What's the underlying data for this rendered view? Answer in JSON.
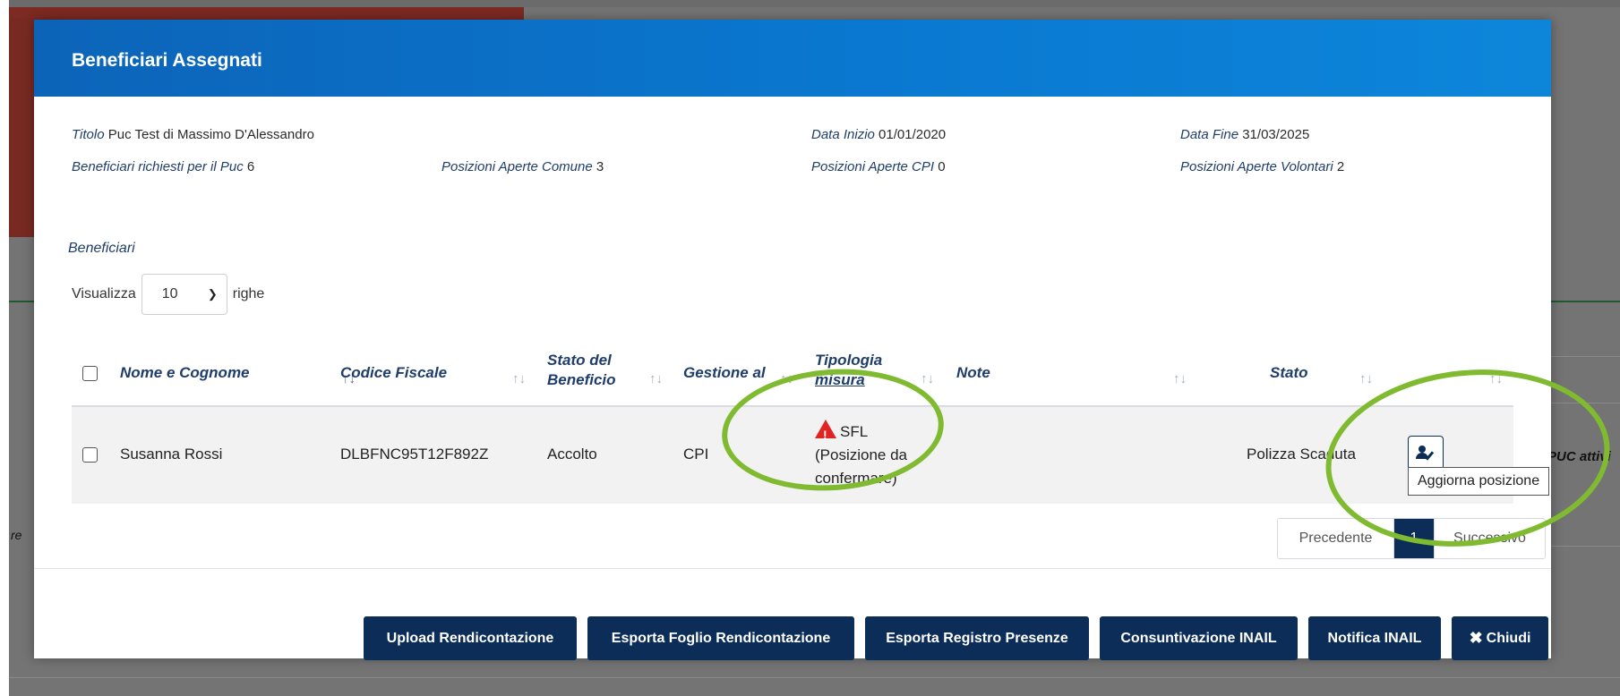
{
  "modal": {
    "title": "Beneficiari Assegnati",
    "info": {
      "titolo_label": "Titolo",
      "titolo_value": "Puc Test di Massimo D'Alessandro",
      "data_inizio_label": "Data Inizio",
      "data_inizio_value": "01/01/2020",
      "data_fine_label": "Data Fine",
      "data_fine_value": "31/03/2025",
      "beneficiari_richiesti_label": "Beneficiari richiesti per il Puc",
      "beneficiari_richiesti_value": "6",
      "posizioni_comune_label": "Posizioni Aperte Comune",
      "posizioni_comune_value": "3",
      "posizioni_cpi_label": "Posizioni Aperte CPI",
      "posizioni_cpi_value": "0",
      "posizioni_volontari_label": "Posizioni Aperte Volontari",
      "posizioni_volontari_value": "2"
    },
    "section_label": "Beneficiari",
    "show": {
      "prefix": "Visualizza",
      "selected": "10",
      "suffix": "righe"
    },
    "table": {
      "headers": {
        "nome": "Nome e Cognome",
        "codice": "Codice Fiscale",
        "stato_beneficio_1": "Stato del",
        "stato_beneficio_2": "Beneficio",
        "gestione": "Gestione al",
        "tipologia_1": "Tipologia",
        "tipologia_2": "misura",
        "note": "Note",
        "stato": "Stato"
      },
      "sort_glyph": "↑↓",
      "rows": [
        {
          "nome": "Susanna Rossi",
          "codice": "DLBFNC95T12F892Z",
          "stato_beneficio": "Accolto",
          "gestione": "CPI",
          "tipologia_1": "SFL",
          "tipologia_2": "(Posizione da",
          "tipologia_3": "confermare)",
          "note": "",
          "stato": "Polizza Scaduta"
        }
      ]
    },
    "tooltip": "Aggiorna posizione",
    "pagination": {
      "prev": "Precedente",
      "current": "1",
      "next": "Successivo"
    },
    "footer_buttons": {
      "upload": "Upload Rendicontazione",
      "esporta_foglio": "Esporta Foglio Rendicontazione",
      "esporta_registro": "Esporta Registro Presenze",
      "consuntivazione": "Consuntivazione INAIL",
      "notifica": "Notifica INAIL",
      "chiudi": "Chiudi"
    }
  },
  "background": {
    "partial_text_right": "PUC attivi",
    "partial_text_left": "re"
  },
  "colors": {
    "header_blue": "#0a78d0",
    "primary_navy": "#0b2d57",
    "highlight_green": "#7fba30",
    "warning_red": "#e02424"
  },
  "icons": {
    "warning": "warning-triangle-icon",
    "action": "user-edit-icon",
    "close": "x-icon",
    "select": "chevron-down-icon"
  }
}
